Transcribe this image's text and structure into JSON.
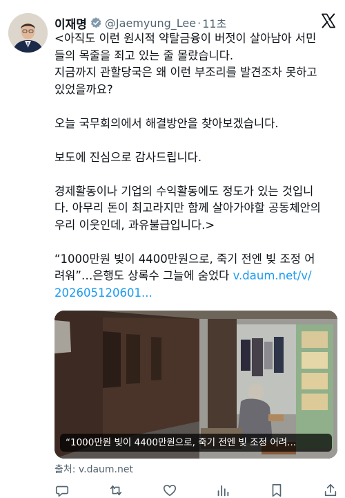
{
  "author": {
    "name": "이재명",
    "handle": "@Jaemyung_Lee",
    "separator": "·",
    "time": "11초"
  },
  "tweet": {
    "lines": [
      "<아직도 이런 원시적 약탈금융이 버젓이 살아남아 서민",
      "들의 목줄을 죄고 있는 줄 몰랐습니다.",
      "지금까지 관할당국은 왜 이런 부조리를 발견조차 못하고",
      "있었을까요?",
      "오늘 국무회의에서 해결방안을 찾아보겠습니다.",
      "보도에 진심으로 감사드립니다.",
      "경제활동이나 기업의 수익활동에도 정도가 있는 것입니",
      "다. 아무리 돈이 최고라지만 함께 살아가야할 공동체안의",
      "우리 이웃인데, 과유불급입니다.>",
      "“1000만원 빚이 4400만원으로, 죽기 전엔 빚 조정 어",
      "려워”…은행도 상록수 그늘에 숨었다"
    ],
    "link_part1": "v.daum.net/v/",
    "link_part2": "202605120601..."
  },
  "media": {
    "caption": "“1000만원 빚이 4400만원으로, 죽기 전엔 빚 조정 어려...",
    "source": "출처: v.daum.net"
  },
  "icons": {
    "verified": "verified-badge-icon",
    "logo": "x-logo-icon",
    "actions": [
      "reply-icon",
      "retweet-icon",
      "like-icon",
      "views-icon",
      "bookmark-icon",
      "share-icon"
    ]
  },
  "colors": {
    "link": "#1d9bf0",
    "secondary_text": "#536471",
    "verified": "#829aab"
  }
}
